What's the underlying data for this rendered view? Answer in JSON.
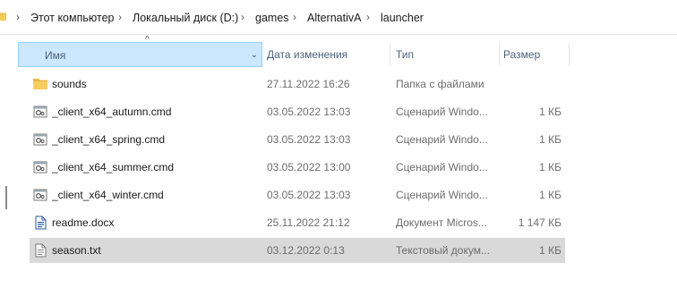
{
  "breadcrumb": {
    "segments": [
      "Этот компьютер",
      "Локальный диск (D:)",
      "games",
      "AlternativA",
      "launcher"
    ],
    "separator": "›"
  },
  "columns": {
    "name": "Имя",
    "date": "Дата изменения",
    "type": "Тип",
    "size": "Размер",
    "sort_arrow": "^",
    "chevron": "⌄"
  },
  "files": [
    {
      "name": "sounds",
      "date": "27.11.2022 16:26",
      "type": "Папка с файлами",
      "size": "",
      "icon": "folder-icon"
    },
    {
      "name": "_client_x64_autumn.cmd",
      "date": "03.05.2022 13:03",
      "type": "Сценарий Windo...",
      "size": "1 КБ",
      "icon": "cmd-file-icon"
    },
    {
      "name": "_client_x64_spring.cmd",
      "date": "03.05.2022 13:03",
      "type": "Сценарий Windo...",
      "size": "1 КБ",
      "icon": "cmd-file-icon"
    },
    {
      "name": "_client_x64_summer.cmd",
      "date": "03.05.2022 13:00",
      "type": "Сценарий Windo...",
      "size": "1 КБ",
      "icon": "cmd-file-icon"
    },
    {
      "name": "_client_x64_winter.cmd",
      "date": "03.05.2022 13:03",
      "type": "Сценарий Windo...",
      "size": "1 КБ",
      "icon": "cmd-file-icon"
    },
    {
      "name": "readme.docx",
      "date": "25.11.2022 21:12",
      "type": "Документ Micros...",
      "size": "1 147 КБ",
      "icon": "word-doc-icon"
    },
    {
      "name": "season.txt",
      "date": "03.12.2022 0:13",
      "type": "Текстовый докум...",
      "size": "1 КБ",
      "icon": "text-file-icon",
      "selected": true
    }
  ],
  "colors": {
    "selection": "#d9d9d9",
    "header_highlight": "#cce8ff",
    "folder": "#e8b54a",
    "word": "#2b579a"
  }
}
